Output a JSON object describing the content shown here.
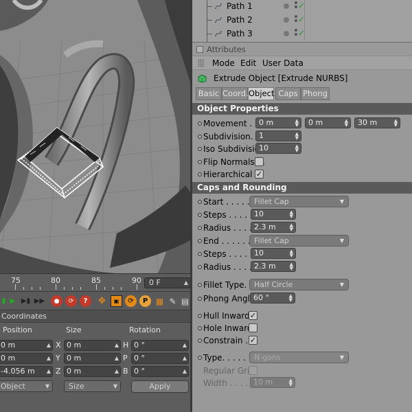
{
  "object_list": {
    "rows": [
      {
        "label": "Path 1"
      },
      {
        "label": "Path 2"
      },
      {
        "label": "Path 3"
      }
    ]
  },
  "attributes": {
    "title": "Attributes",
    "menu": [
      "Mode",
      "Edit",
      "User Data"
    ],
    "object_name": "Extrude Object [Extrude NURBS]",
    "tabs": [
      "Basic",
      "Coord.",
      "Object",
      "Caps",
      "Phong"
    ],
    "active_tab": "Object",
    "object_properties": {
      "heading": "Object Properties",
      "movement_label": "Movement . . . .",
      "movement_x": "0 m",
      "movement_y": "0 m",
      "movement_z": "30 m",
      "subdivision_label": "Subdivision. . .",
      "subdivision": "1",
      "iso_subdivision_label": "Iso Subdivision",
      "iso_subdivision": "10",
      "flip_normals_label": "Flip Normals . .",
      "flip_normals": false,
      "hierarchical_label": "Hierarchical . .",
      "hierarchical": true
    },
    "caps": {
      "heading": "Caps and Rounding",
      "start_label": "Start . . . . . . .",
      "start": "Fillet Cap",
      "start_steps_label": "Steps . . . . . .",
      "start_steps": "10",
      "start_radius_label": "Radius . . . . .",
      "start_radius": "2.3 m",
      "end_label": "End . . . . . . . .",
      "end": "Fillet Cap",
      "end_steps_label": "Steps . . . . . .",
      "end_steps": "10",
      "end_radius_label": "Radius . . . . .",
      "end_radius": "2.3 m",
      "fillet_type_label": "Fillet Type. . .",
      "fillet_type": "Half Circle",
      "phong_angle_label": "Phong Angle",
      "phong_angle": "60 °",
      "hull_inwards_label": "Hull Inwards",
      "hull_inwards": true,
      "hole_inwards_label": "Hole Inwards",
      "hole_inwards": false,
      "constrain_label": "Constrain . . .",
      "constrain": true,
      "type_label": "Type. . . . . . . .",
      "type": "N-gons",
      "regular_grid_label": "Regular Grid",
      "regular_grid": false,
      "width_label": "Width . . . . . .",
      "width": "10 m"
    }
  },
  "timeline": {
    "ticks": [
      "75",
      "80",
      "85",
      "90"
    ],
    "current_frame": "0 F"
  },
  "coordinates": {
    "title": "Coordinates",
    "col_position": "Position",
    "col_size": "Size",
    "col_rotation": "Rotation",
    "rows": [
      {
        "pos": "0 m",
        "axis": "X",
        "size": "0 m",
        "rot_axis": "H",
        "rot": "0 °"
      },
      {
        "pos": "0 m",
        "axis": "Y",
        "size": "0 m",
        "rot_axis": "P",
        "rot": "0 °"
      },
      {
        "pos": "-4.056 m",
        "axis": "Z",
        "size": "0 m",
        "rot_axis": "B",
        "rot": "0 °"
      }
    ],
    "mode_select": "Object",
    "size_select": "Size",
    "apply_label": "Apply"
  },
  "colors": {
    "section_header": "#5a5a5a",
    "active_tab": "#cfcfcf",
    "viewport_bg": "#8e8e8e"
  }
}
